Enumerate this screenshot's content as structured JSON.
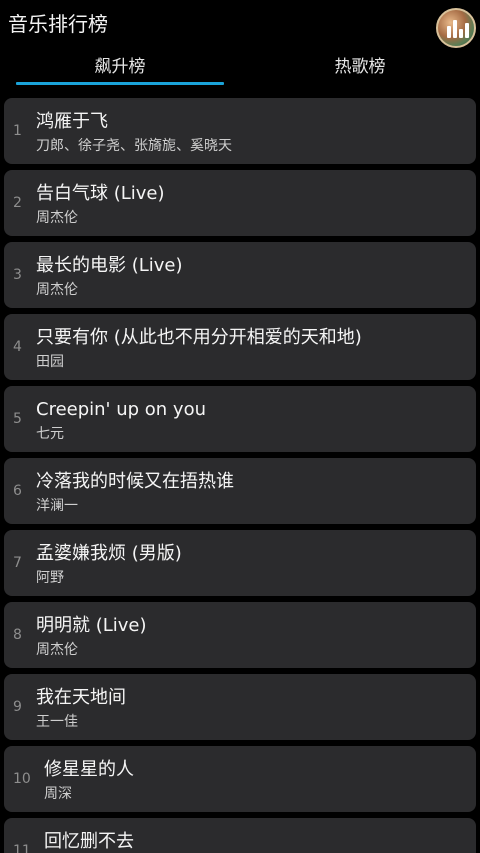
{
  "appbar": {
    "title": "音乐排行榜",
    "avatar_icon": "equalizer-bars-icon"
  },
  "tabs": [
    {
      "label": "飙升榜",
      "selected": true
    },
    {
      "label": "热歌榜",
      "selected": false
    }
  ],
  "accent_color": "#1aa3d9",
  "songs": [
    {
      "rank": "1",
      "title": "鸿雁于飞",
      "artist": "刀郎、徐子尧、张旖旎、奚晓天"
    },
    {
      "rank": "2",
      "title": "告白气球 (Live)",
      "artist": "周杰伦"
    },
    {
      "rank": "3",
      "title": "最长的电影 (Live)",
      "artist": "周杰伦"
    },
    {
      "rank": "4",
      "title": "只要有你 (从此也不用分开相爱的天和地)",
      "artist": "田园"
    },
    {
      "rank": "5",
      "title": "Creepin' up on you",
      "artist": "七元"
    },
    {
      "rank": "6",
      "title": "冷落我的时候又在捂热谁",
      "artist": "洋澜一"
    },
    {
      "rank": "7",
      "title": "孟婆嫌我烦 (男版)",
      "artist": "阿野"
    },
    {
      "rank": "8",
      "title": "明明就 (Live)",
      "artist": "周杰伦"
    },
    {
      "rank": "9",
      "title": "我在天地间",
      "artist": "王一佳"
    },
    {
      "rank": "10",
      "title": "修星星的人",
      "artist": "周深"
    },
    {
      "rank": "11",
      "title": "回忆删不去",
      "artist": ""
    }
  ]
}
